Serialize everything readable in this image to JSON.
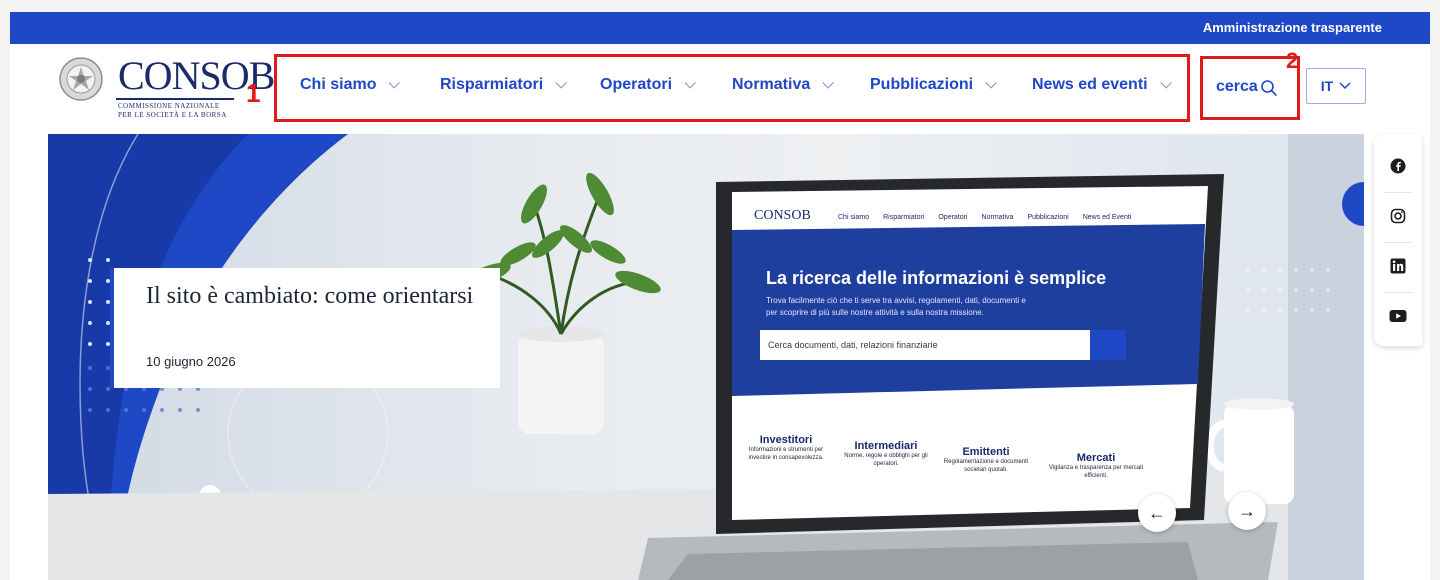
{
  "topbar": {
    "link": "Amministrazione trasparente"
  },
  "logo": {
    "wordmark": "CONSOB",
    "subtitle_line1": "COMMISSIONE NAZIONALE",
    "subtitle_line2": "PER LE SOCIETÀ E LA BORSA"
  },
  "annotations": {
    "nav_number": "1",
    "search_number": "2"
  },
  "nav": {
    "items": [
      {
        "label": "Chi siamo"
      },
      {
        "label": "Risparmiatori"
      },
      {
        "label": "Operatori"
      },
      {
        "label": "Normativa"
      },
      {
        "label": "Pubblicazioni"
      },
      {
        "label": "News ed eventi"
      }
    ]
  },
  "search": {
    "label": "cerca"
  },
  "language": {
    "selected": "IT"
  },
  "hero": {
    "title": "Il sito è cambiato: come orientarsi",
    "date": "10 giugno 2026",
    "laptop_screen": {
      "logo": "CONSOB",
      "nav": [
        "Chi siamo",
        "Risparmiatori",
        "Operatori",
        "Normativa",
        "Pubblicazioni",
        "News ed Eventi"
      ],
      "headline": "La ricerca delle informazioni è semplice",
      "intro_line1": "Trova facilmente ciò che ti serve tra avvisi, regolamenti, dati, documenti e",
      "intro_line2": "per scoprire di più sulle nostre attività e sulla nostra missione.",
      "search_placeholder": "Cerca documenti, dati, relazioni finanziarie",
      "tiles": [
        {
          "title": "Investitori",
          "desc": "Informazioni e strumenti per investire in consapevolezza."
        },
        {
          "title": "Intermediari",
          "desc": "Norme, regole e obblighi per gli operatori."
        },
        {
          "title": "Emittenti",
          "desc": "Regolamentazione e documenti societari quotati."
        },
        {
          "title": "Mercati",
          "desc": "Vigilanza e trasparenza per mercati efficienti."
        }
      ]
    },
    "prev_label": "←",
    "next_label": "→"
  },
  "social": [
    "facebook-icon",
    "instagram-icon",
    "linkedin-icon",
    "youtube-icon"
  ],
  "colors": {
    "brand_blue": "#1f48c7",
    "annotation_red": "#e01a1a",
    "navy": "#1a2a6b"
  }
}
